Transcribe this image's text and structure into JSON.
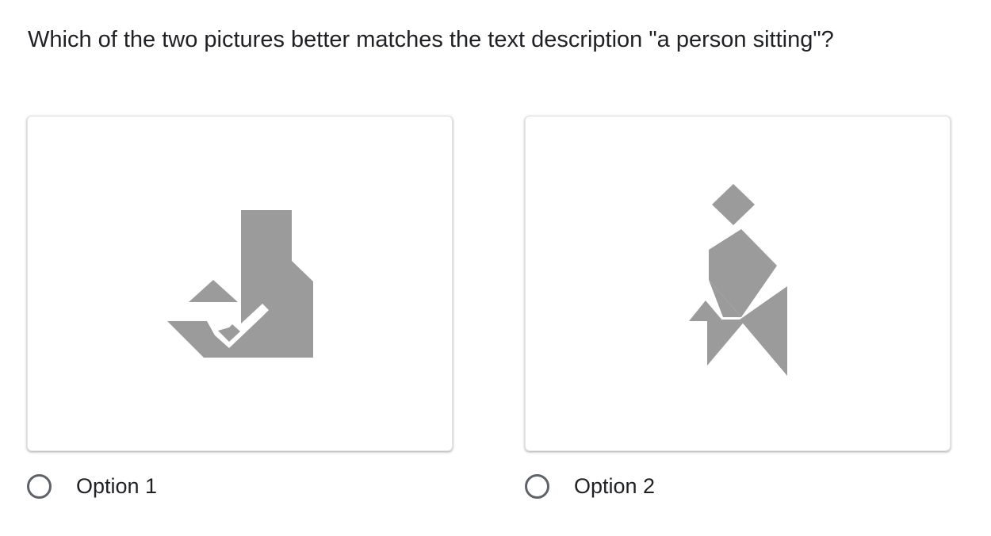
{
  "question": {
    "text": "Which of the two pictures better matches the text description \"a person sitting\"?"
  },
  "options": [
    {
      "label": "Option 1",
      "selected": false,
      "image": "tangram-figure-1"
    },
    {
      "label": "Option 2",
      "selected": false,
      "image": "tangram-figure-2"
    }
  ],
  "colors": {
    "shape_fill": "#9b9b9b",
    "text": "#202124",
    "radio_border": "#5f6368"
  }
}
